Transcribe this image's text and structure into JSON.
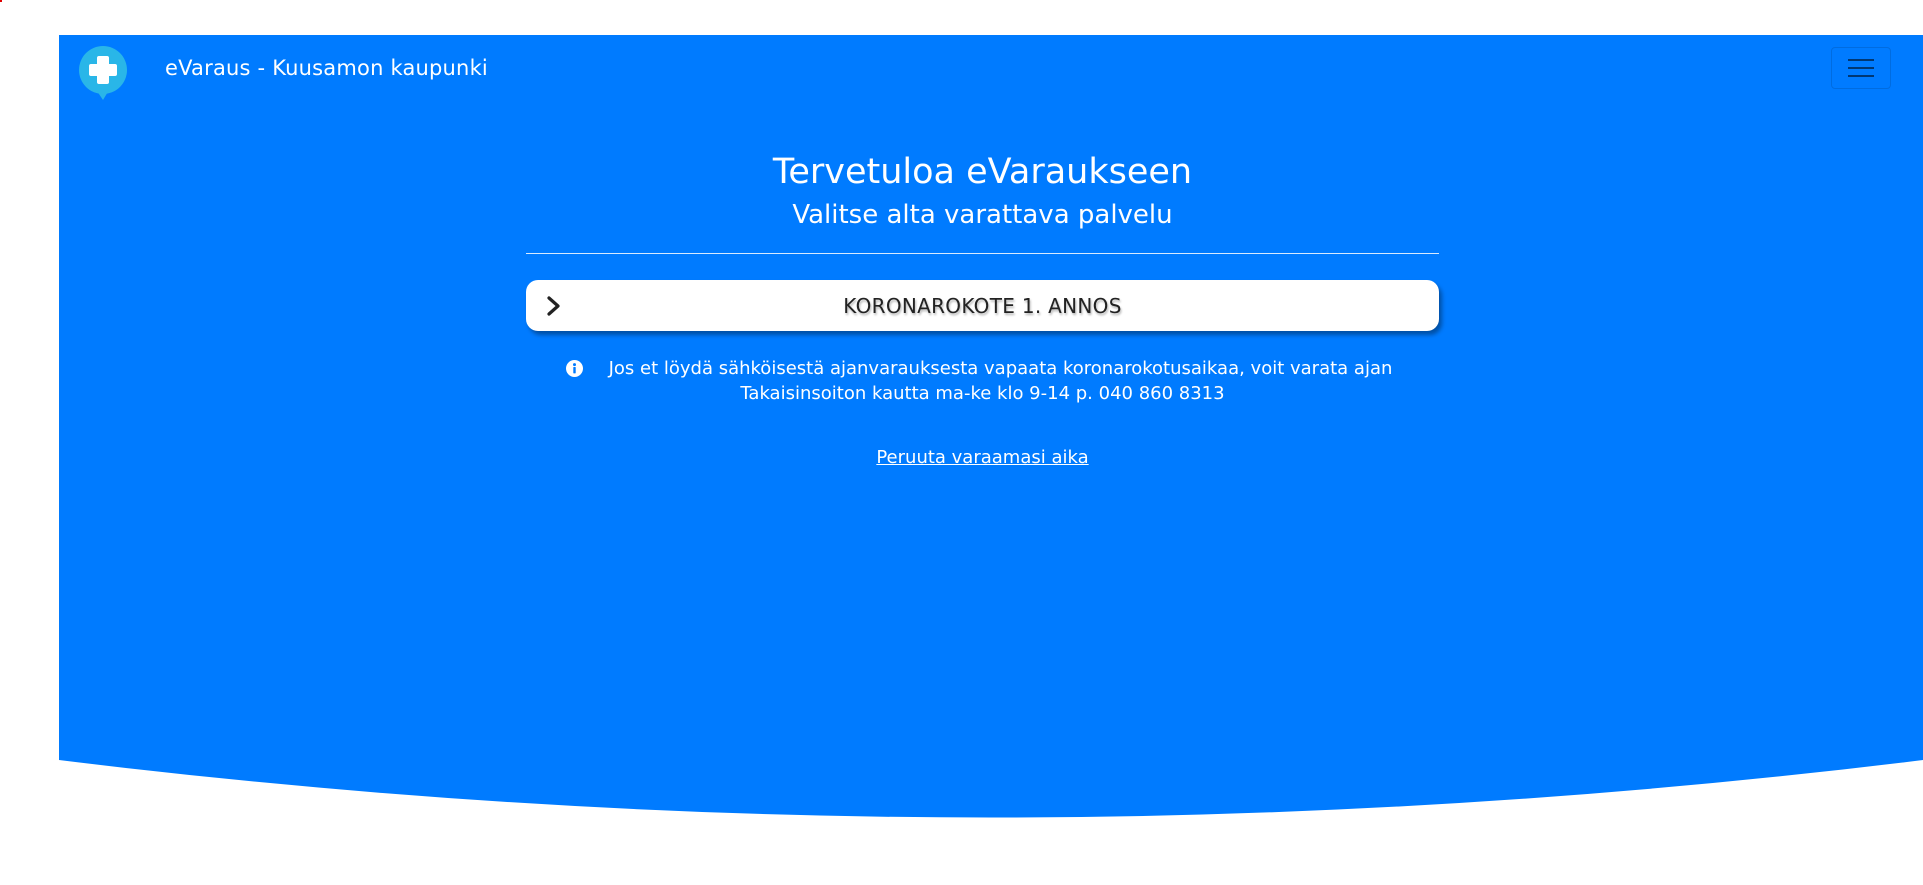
{
  "colors": {
    "primary": "#007bff",
    "logo_bubble": "#29b6e8",
    "button_bg": "#ffffff",
    "button_text": "#222222"
  },
  "navbar": {
    "brand": "eVaraus - Kuusamon kaupunki",
    "logo_icon": "medical-cross-icon",
    "menu_icon": "hamburger-menu-icon"
  },
  "main": {
    "title": "Tervetuloa eVaraukseen",
    "subtitle": "Valitse alta varattava palvelu",
    "services": [
      {
        "label": "KORONAROKOTE 1. ANNOS",
        "icon": "chevron-right-icon"
      }
    ],
    "info": {
      "icon": "info-circle-icon",
      "line1": "Jos et löydä sähköisestä ajanvarauksesta vapaata koronarokotusaikaa, voit varata ajan",
      "line2": "Takaisinsoiton kautta ma-ke klo 9-14 p. 040 860 8313"
    },
    "cancel_link": "Peruuta varaamasi aika"
  }
}
